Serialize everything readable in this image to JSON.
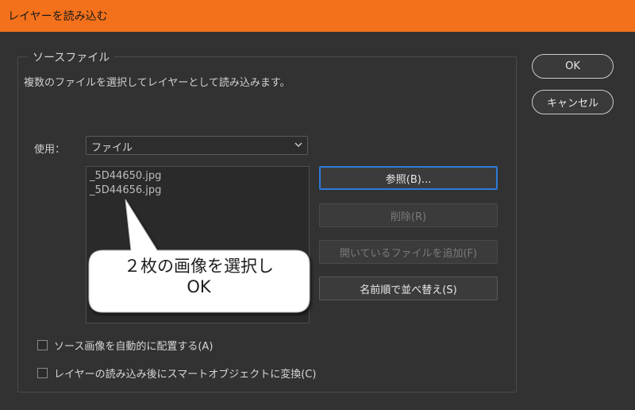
{
  "window": {
    "title": "レイヤーを読み込む"
  },
  "dialog": {
    "group_legend": "ソースファイル",
    "description": "複数のファイルを選択してレイヤーとして読み込みます。",
    "use_label": "使用：",
    "use_select": {
      "value": "ファイル"
    },
    "files": [
      "_5D44650.jpg",
      "_5D44656.jpg"
    ],
    "buttons": {
      "ok": "OK",
      "cancel": "キャンセル",
      "browse": "参照(B)...",
      "remove": "削除(R)",
      "add_open": "開いているファイルを追加(F)",
      "sort": "名前順で並べ替え(S)"
    },
    "checkboxes": {
      "auto_align": "ソース画像を自動的に配置する(A)",
      "smart_object": "レイヤーの読み込み後にスマートオブジェクトに変換(C)"
    }
  },
  "callout": {
    "line1": "２枚の画像を選択し",
    "line2": "OK"
  }
}
